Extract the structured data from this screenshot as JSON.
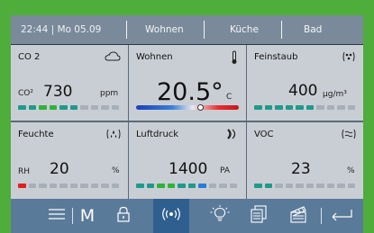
{
  "topbar": {
    "clock": "22:44 | Mo 05.09",
    "tabs": [
      "Wohnen",
      "Küche",
      "Bad"
    ]
  },
  "tiles": {
    "co2": {
      "title": "CO 2",
      "prefix": "CO²",
      "value": "730",
      "unit": "ppm",
      "icon": "cloud-icon"
    },
    "wohnen": {
      "title": "Wohnen",
      "value": "20.5°",
      "unit": "C",
      "icon": "thermometer-icon",
      "level": 0.62
    },
    "feinstaub": {
      "title": "Feinstaub",
      "value": "400",
      "unit": "µg/m³",
      "icon": "particles-icon"
    },
    "feuchte": {
      "title": "Feuchte",
      "prefix": "RH",
      "value": "20",
      "unit": "%",
      "icon": "droplets-icon"
    },
    "luftdruck": {
      "title": "Luftdruck",
      "value": "1400",
      "unit": "PA",
      "icon": "pressure-icon"
    },
    "voc": {
      "title": "VOC",
      "value": "23",
      "unit": "%",
      "icon": "wind-icon"
    }
  },
  "bottombar": {
    "m_label": "M",
    "buttons": [
      "menu-icon",
      "m-icon",
      "lock-icon",
      "wireless-icon",
      "bulb-icon",
      "document-icon",
      "clapper-icon",
      "back-icon"
    ]
  },
  "colors": {
    "background": "#4fad3c",
    "frame": "#2a3a4c",
    "tile": "#c9ced4",
    "active_button": "#2f5f8f",
    "seg_teal": "#1f9a8a",
    "seg_green": "#2fb23a",
    "seg_gray": "#a7afb8",
    "seg_red": "#e02020",
    "seg_blue": "#2a7bd6"
  }
}
